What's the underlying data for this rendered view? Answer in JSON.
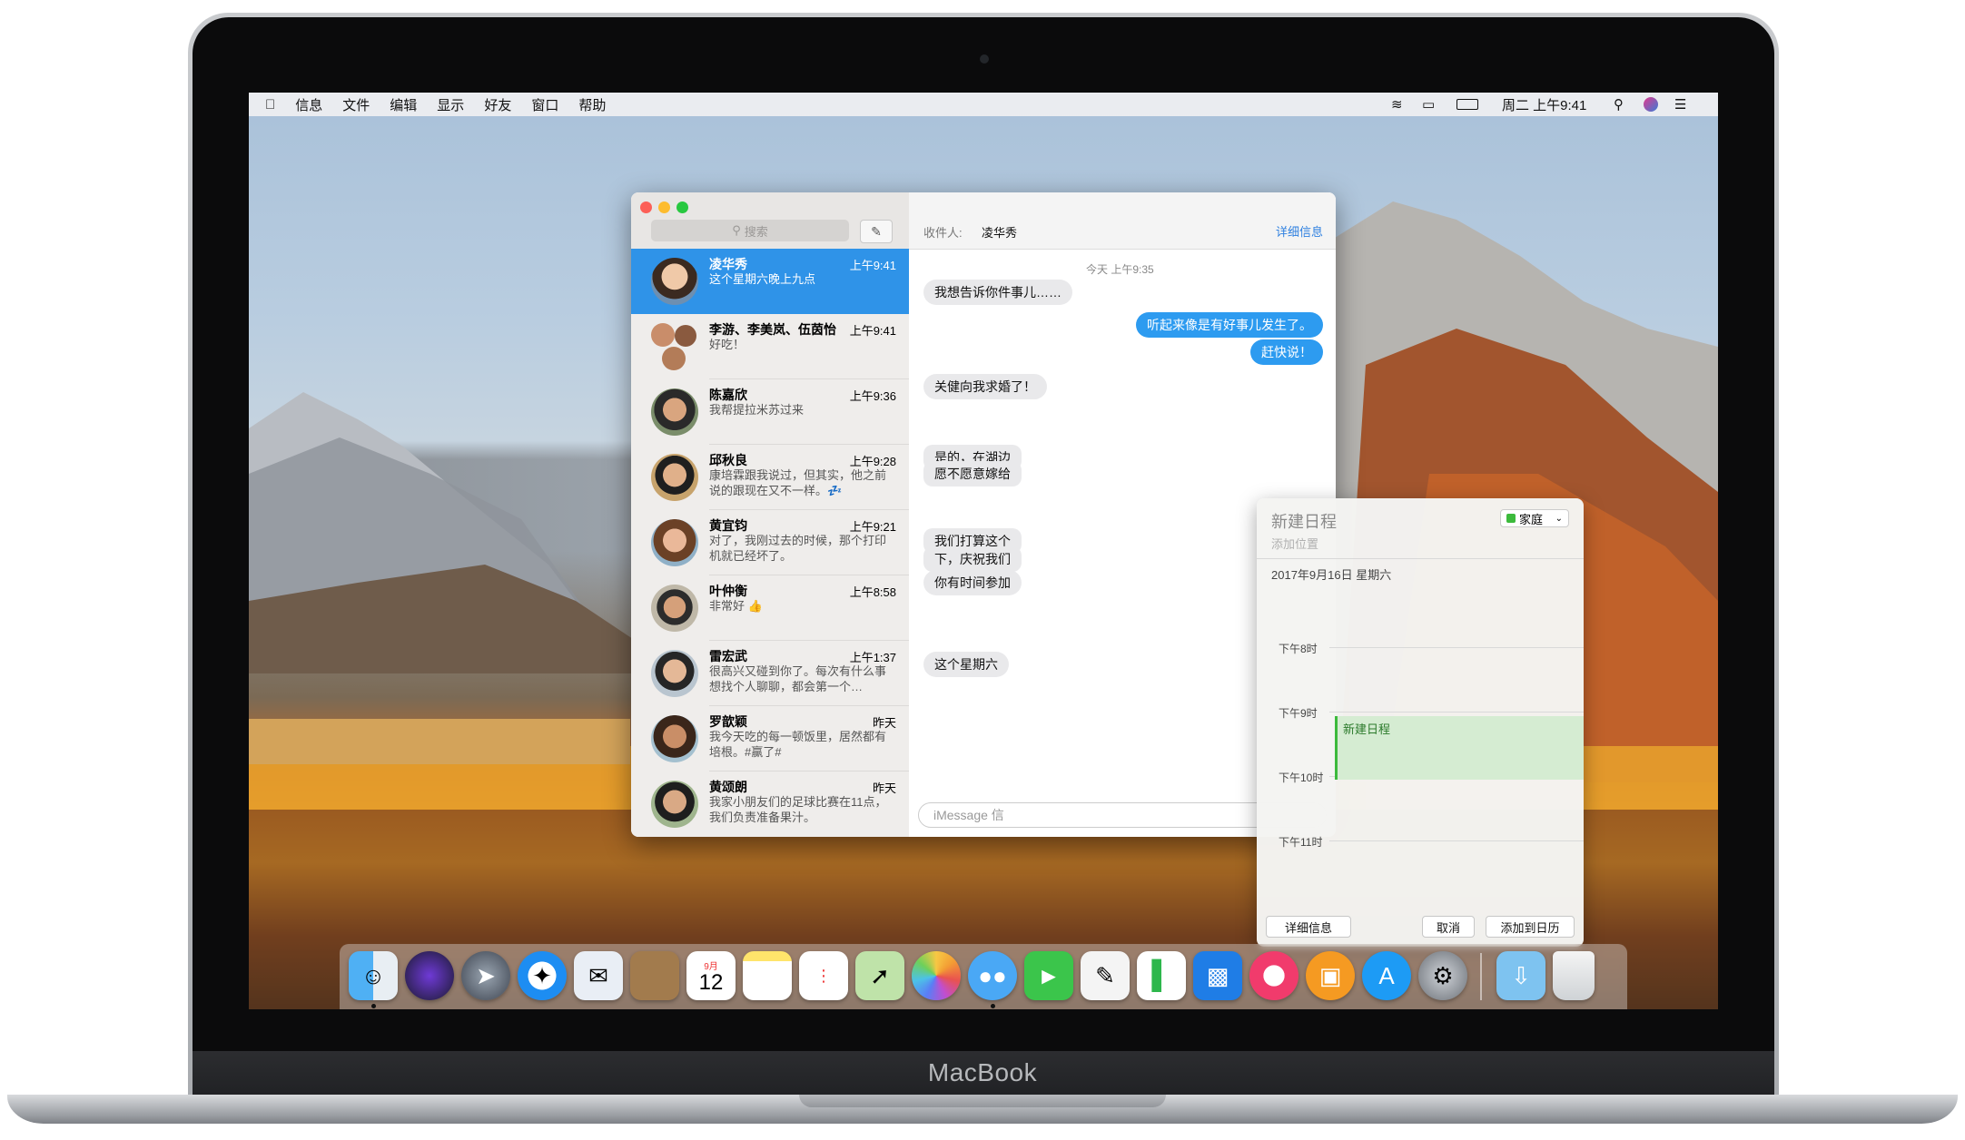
{
  "device": {
    "brand": "MacBook"
  },
  "menubar": {
    "items": [
      "信息",
      "文件",
      "编辑",
      "显示",
      "好友",
      "窗口",
      "帮助"
    ],
    "clock": "周二 上午9:41"
  },
  "messages": {
    "search_placeholder": "搜索",
    "recipient_label": "收件人:",
    "recipient_name": "凌华秀",
    "details_link": "详细信息",
    "input_placeholder": "iMessage 信",
    "conversations": [
      {
        "name": "凌华秀",
        "time": "上午9:41",
        "preview": "这个星期六晚上九点",
        "selected": true
      },
      {
        "name": "李游、李美岚、伍茵怡",
        "time": "上午9:41",
        "preview": "好吃！"
      },
      {
        "name": "陈嘉欣",
        "time": "上午9:36",
        "preview": "我帮提拉米苏过来"
      },
      {
        "name": "邱秋良",
        "time": "上午9:28",
        "preview": "康培霖跟我说过，但其实，他之前说的跟现在又不一样。💤"
      },
      {
        "name": "黄宜钧",
        "time": "上午9:21",
        "preview": "对了，我刚过去的时候，那个打印机就已经坏了。"
      },
      {
        "name": "叶仲衡",
        "time": "上午8:58",
        "preview": "非常好 👍"
      },
      {
        "name": "雷宏武",
        "time": "上午1:37",
        "preview": "很高兴又碰到你了。每次有什么事想找个人聊聊，都会第一个…"
      },
      {
        "name": "罗歆颖",
        "time": "昨天",
        "preview": "我今天吃的每一顿饭里，居然都有培根。#赢了#"
      },
      {
        "name": "黄颂朗",
        "time": "昨天",
        "preview": "我家小朋友们的足球比赛在11点，我们负责准备果汁。"
      }
    ],
    "thread": {
      "timestamp": "今天 上午9:35",
      "bubbles": [
        {
          "text": "我想告诉你件事儿……",
          "from": "them"
        },
        {
          "text": "听起来像是有好事儿发生了。",
          "from": "me"
        },
        {
          "text": "赶快说！",
          "from": "me"
        },
        {
          "text": "关健向我求婚了！",
          "from": "them"
        },
        {
          "text": "是的，在湖边",
          "from": "them"
        },
        {
          "text": "愿不愿意嫁给",
          "from": "them"
        },
        {
          "text": "我们打算这个",
          "from": "them"
        },
        {
          "text": "下，庆祝我们",
          "from": "them"
        },
        {
          "text": "你有时间参加",
          "from": "them"
        },
        {
          "text": "这个星期六",
          "from": "them"
        }
      ]
    }
  },
  "event_popover": {
    "title": "新建日程",
    "location_placeholder": "添加位置",
    "calendar": "家庭",
    "calendar_color": "#3cba3c",
    "date": "2017年9月16日 星期六",
    "hours": [
      "下午8时",
      "下午9时",
      "下午10时",
      "下午11时"
    ],
    "event_label": "新建日程",
    "buttons": {
      "details": "详细信息",
      "cancel": "取消",
      "add": "添加到日历"
    }
  },
  "dock": {
    "calendar_month": "9月",
    "calendar_day": "12"
  },
  "colors": {
    "accent": "#2f93e8",
    "bubble_blue": "#2d9bf0",
    "event_green": "#d5ecd2"
  }
}
